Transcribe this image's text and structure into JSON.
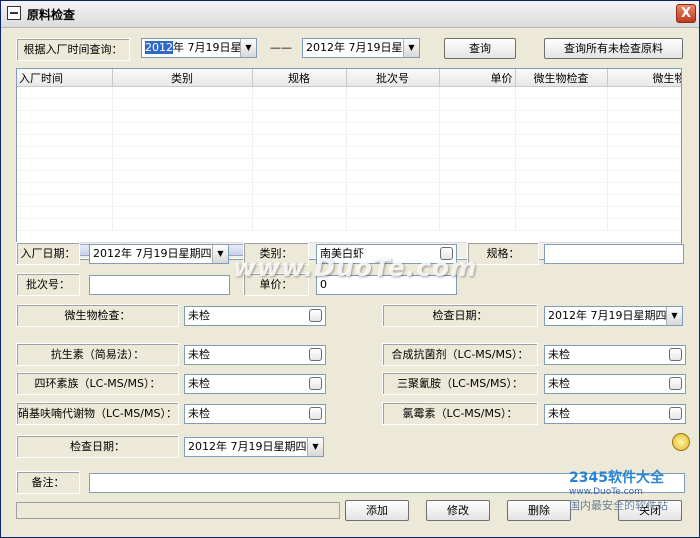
{
  "window": {
    "title": "原料检查",
    "close_label": "X"
  },
  "query": {
    "label": "根据入厂时间查询：",
    "date_from_sel": "2012",
    "date_from_rest": "年 7月19日星期",
    "separator": "——",
    "date_to": "2012年 7月19日星期",
    "search_button": "查询",
    "search_all_button": "查询所有未检查原料"
  },
  "grid": {
    "columns": [
      "入厂时间",
      "类别",
      "规格",
      "批次号",
      "单价",
      "微生物检查",
      "微生物检"
    ],
    "rows": []
  },
  "form": {
    "entry_date_label": "入厂日期：",
    "entry_date_value": "2012年 7月19日星期四",
    "category_label": "类别：",
    "category_value": "南美白虾",
    "spec_label": "规格：",
    "spec_value": "",
    "batch_label": "批次号：",
    "batch_value": "",
    "price_label": "单价：",
    "price_value": "0",
    "micro_label": "微生物检查：",
    "micro_value": "未检",
    "check_date_label": "检查日期：",
    "check_date_value": "2012年 7月19日星期四",
    "antibiotic_label": "抗生素（简易法）：",
    "antibiotic_value": "未检",
    "synth_label": "合成抗菌剂（LC-MS/MS）：",
    "synth_value": "未检",
    "tetra_label": "四环素族（LC-MS/MS）：",
    "tetra_value": "未检",
    "melamine_label": "三聚氰胺（LC-MS/MS）：",
    "melamine_value": "未检",
    "nitro_label": "硝基呋喃代谢物（LC-MS/MS）：",
    "nitro_value": "未检",
    "chloram_label": "氯霉素（LC-MS/MS）：",
    "chloram_value": "未检",
    "check_date2_label": "检查日期：",
    "check_date2_value": "2012年 7月19日星期四",
    "remark_label": "备注：",
    "remark_value": ""
  },
  "actions": {
    "add": "添加",
    "modify": "修改",
    "delete": "删除",
    "close": "关闭"
  },
  "watermarks": {
    "center": "www.DuoTe.com",
    "brand": "2345软件大全",
    "site": "www.DuoTe.com",
    "slogan": "国内最安全的软件站"
  }
}
